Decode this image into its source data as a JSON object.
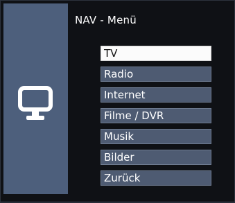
{
  "header": {
    "title": "NAV - Menü"
  },
  "sidebar": {
    "icon": "tv-icon"
  },
  "menu": {
    "items": [
      {
        "label": "TV",
        "selected": true
      },
      {
        "label": "Radio",
        "selected": false
      },
      {
        "label": "Internet",
        "selected": false
      },
      {
        "label": "Filme / DVR",
        "selected": false
      },
      {
        "label": "Musik",
        "selected": false
      },
      {
        "label": "Bilder",
        "selected": false
      },
      {
        "label": "Zurück",
        "selected": false
      }
    ]
  },
  "colors": {
    "background": "#0f1115",
    "side_panel": "#4d5f7c",
    "menu_item": "#4e5b72",
    "menu_item_selected": "#fbfbfb"
  }
}
